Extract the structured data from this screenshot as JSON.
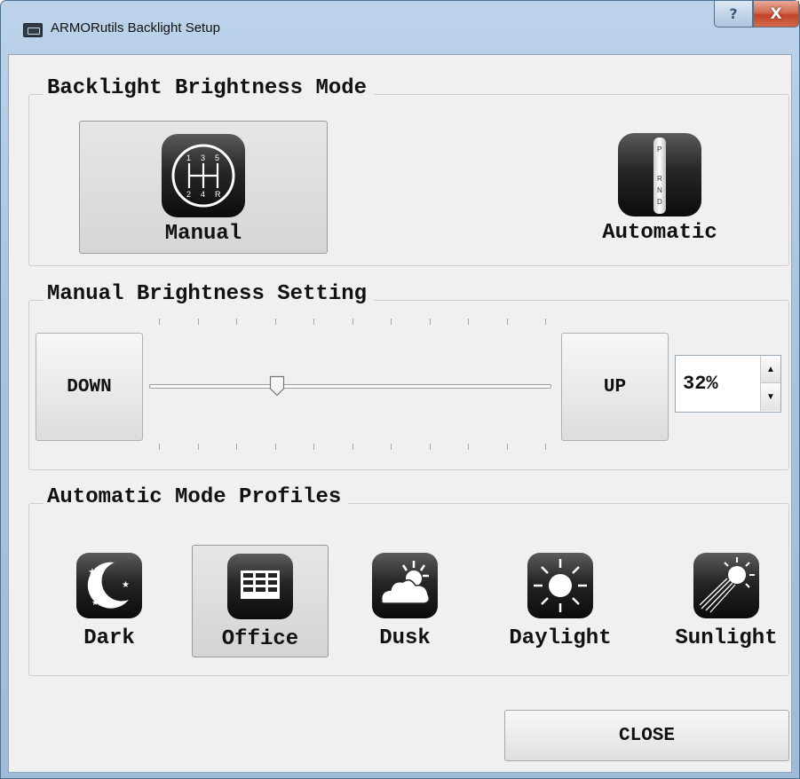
{
  "window": {
    "title": "ARMORutils Backlight Setup",
    "help_glyph": "?",
    "close_glyph": "X"
  },
  "mode_group": {
    "title": "Backlight Brightness Mode",
    "selected": "Manual",
    "options": [
      {
        "label": "Manual",
        "icon": "manual-gearshift-icon",
        "gear_numbers": [
          "1",
          "3",
          "5",
          "2",
          "4",
          "R"
        ]
      },
      {
        "label": "Automatic",
        "icon": "automatic-gearshift-icon",
        "gear_letters": [
          "P",
          "R",
          "N",
          "D"
        ]
      }
    ]
  },
  "manual_group": {
    "title": "Manual Brightness Setting",
    "down_label": "DOWN",
    "up_label": "UP",
    "value_text": "32%",
    "slider_value": 32,
    "slider_min": 0,
    "slider_max": 100
  },
  "profiles_group": {
    "title": "Automatic Mode Profiles",
    "selected": "Office",
    "items": [
      {
        "label": "Dark",
        "icon": "moon-stars-icon"
      },
      {
        "label": "Office",
        "icon": "office-building-icon"
      },
      {
        "label": "Dusk",
        "icon": "cloud-sun-icon"
      },
      {
        "label": "Daylight",
        "icon": "sun-icon"
      },
      {
        "label": "Sunlight",
        "icon": "bright-sun-rays-icon"
      }
    ]
  },
  "footer": {
    "close_label": "CLOSE"
  },
  "colors": {
    "titlebar": "#aec6e0",
    "client_bg": "#f0f0f0",
    "selected_bg": "#dadada",
    "icon_dark": "#1c1c1c",
    "close_red": "#c7472c"
  }
}
